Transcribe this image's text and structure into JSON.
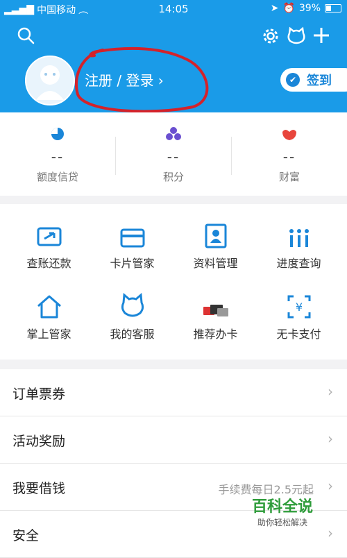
{
  "status_bar": {
    "carrier": "中国移动",
    "time": "14:05",
    "battery": "39%"
  },
  "header": {
    "login_text": "注册 / 登录 ›",
    "checkin_label": "签到",
    "icons": [
      "search-icon",
      "settings-gear-icon",
      "customer-service-icon",
      "add-icon"
    ]
  },
  "stats": [
    {
      "value": "--",
      "label": "额度信贷",
      "color": "#1a86d8"
    },
    {
      "value": "--",
      "label": "积分",
      "color": "#6a4fd0"
    },
    {
      "value": "--",
      "label": "财富",
      "color": "#e8453c"
    }
  ],
  "services": [
    {
      "label": "查账还款",
      "icon": "bill-icon"
    },
    {
      "label": "卡片管家",
      "icon": "card-icon"
    },
    {
      "label": "资料管理",
      "icon": "profile-icon"
    },
    {
      "label": "进度查询",
      "icon": "progress-icon"
    },
    {
      "label": "掌上管家",
      "icon": "home-icon"
    },
    {
      "label": "我的客服",
      "icon": "service-icon"
    },
    {
      "label": "推荐办卡",
      "icon": "recommend-card-icon"
    },
    {
      "label": "无卡支付",
      "icon": "cardless-pay-icon"
    }
  ],
  "menu": [
    {
      "label": "订单票券",
      "hint": ""
    },
    {
      "label": "活动奖励",
      "hint": ""
    },
    {
      "label": "我要借钱",
      "hint": "手续费每日2.5元起"
    },
    {
      "label": "安全",
      "hint": ""
    }
  ],
  "watermark": {
    "title": "百科全说",
    "subtitle": "助你轻松解决"
  },
  "accent_color": "#1a9be8"
}
